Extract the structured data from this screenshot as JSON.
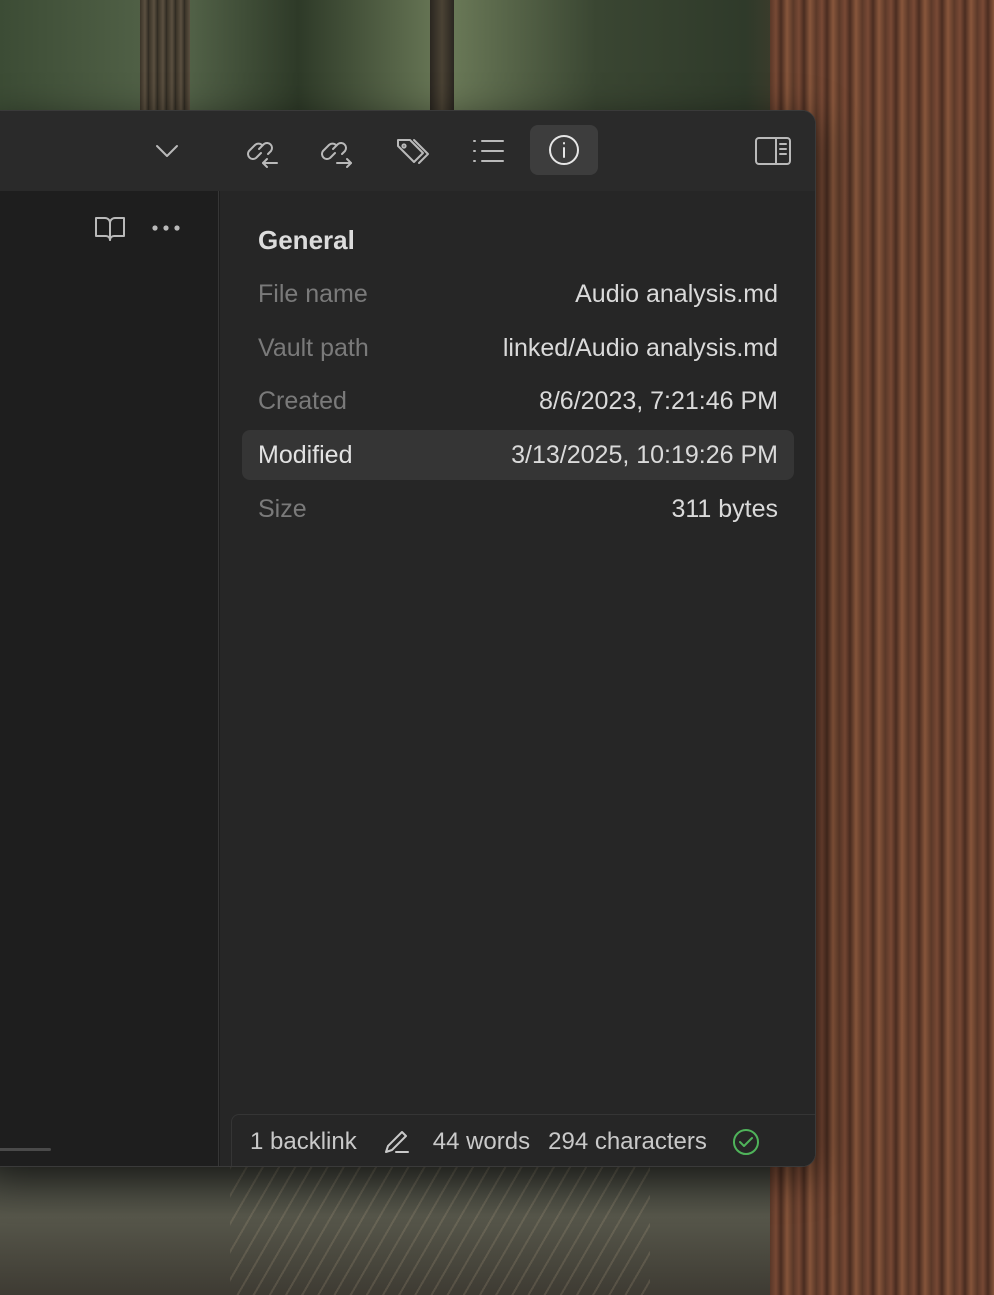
{
  "toolbar": {
    "icons": [
      "chevron-down-icon",
      "backlinks-icon",
      "outgoing-links-icon",
      "tags-icon",
      "outline-icon",
      "info-icon",
      "sidebar-toggle-icon"
    ],
    "active_icon": "info-icon"
  },
  "editor_actions": {
    "icons": [
      "reading-view-icon",
      "more-options-icon"
    ]
  },
  "properties": {
    "section_title": "General",
    "rows": [
      {
        "key": "File name",
        "value": "Audio analysis.md"
      },
      {
        "key": "Vault path",
        "value": "linked/Audio analysis.md"
      },
      {
        "key": "Created",
        "value": "8/6/2023, 7:21:46 PM"
      },
      {
        "key": "Modified",
        "value": "3/13/2025, 10:19:26 PM"
      },
      {
        "key": "Size",
        "value": "311 bytes"
      }
    ],
    "highlighted_row": "Modified"
  },
  "status": {
    "backlinks": "1 backlink",
    "words": "44 words",
    "characters": "294 characters",
    "sync_status_color": "#4fb35a"
  },
  "colors": {
    "window_bg": "#1e1e1e",
    "panel_bg": "#262626",
    "titlebar_bg": "#2a2a2a",
    "accent_green": "#4fb35a"
  }
}
